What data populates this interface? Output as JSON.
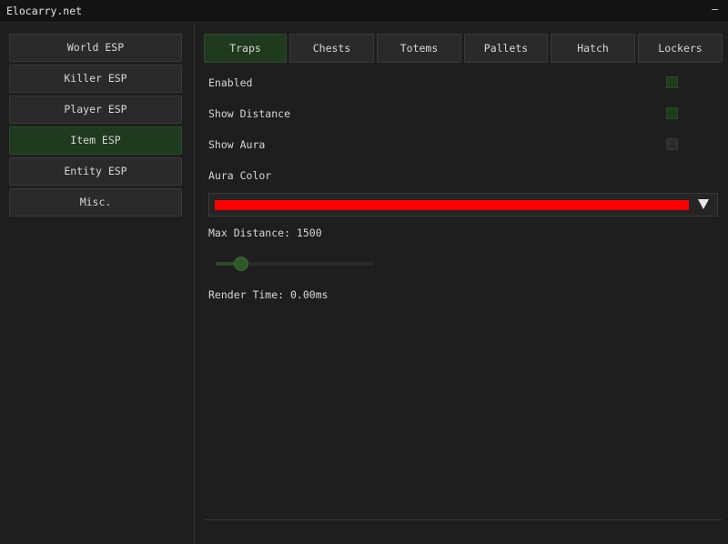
{
  "window": {
    "title": "Elocarry.net",
    "minimize_label": "–"
  },
  "sidebar": {
    "items": [
      {
        "label": "World ESP",
        "active": false
      },
      {
        "label": "Killer ESP",
        "active": false
      },
      {
        "label": "Player ESP",
        "active": false
      },
      {
        "label": "Item ESP",
        "active": true
      },
      {
        "label": "Entity ESP",
        "active": false
      },
      {
        "label": "Misc.",
        "active": false
      }
    ]
  },
  "tabs": [
    {
      "label": "Traps",
      "active": true
    },
    {
      "label": "Chests",
      "active": false
    },
    {
      "label": "Totems",
      "active": false
    },
    {
      "label": "Pallets",
      "active": false
    },
    {
      "label": "Hatch",
      "active": false
    },
    {
      "label": "Lockers",
      "active": false
    }
  ],
  "options": {
    "enabled": {
      "label": "Enabled",
      "checked": true
    },
    "show_distance": {
      "label": "Show Distance",
      "checked": true
    },
    "show_aura": {
      "label": "Show Aura",
      "checked": false
    },
    "aura_color": {
      "label": "Aura Color",
      "value": "#ff0000"
    },
    "max_distance": {
      "label": "Max Distance: 1500",
      "fraction": 0.16
    },
    "render_time": "Render Time: 0.00ms"
  },
  "colors": {
    "accent": "#1f3a1e",
    "panel": "#2a2a2a",
    "background": "#1e1e1e"
  }
}
